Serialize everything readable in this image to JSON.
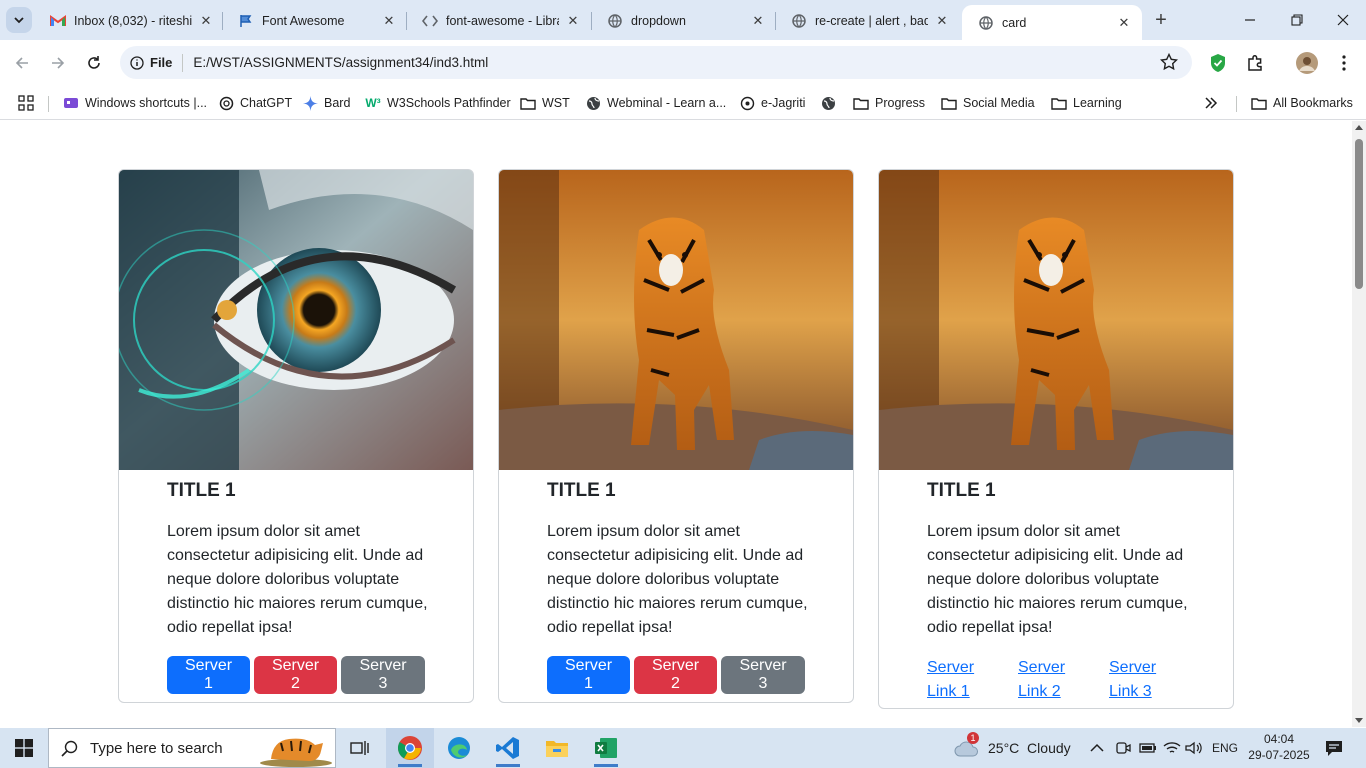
{
  "browser": {
    "tabs": [
      {
        "title": "Inbox (8,032) - riteshi",
        "icon": "gmail-icon"
      },
      {
        "title": "Font Awesome",
        "icon": "font-awesome-icon"
      },
      {
        "title": "font-awesome - Libra",
        "icon": "code-icon"
      },
      {
        "title": "dropdown",
        "icon": "globe-icon"
      },
      {
        "title": "re-create | alert , bad",
        "icon": "globe-icon"
      },
      {
        "title": "card",
        "icon": "globe-icon",
        "active": true
      }
    ],
    "scheme_label": "File",
    "url": "E:/WST/ASSIGNMENTS/assignment34/ind3.html",
    "bookmarks": [
      {
        "label": "Windows shortcuts |...",
        "icon": "app-icon"
      },
      {
        "label": "ChatGPT",
        "icon": "chatgpt-icon"
      },
      {
        "label": "Bard",
        "icon": "sparkle-icon"
      },
      {
        "label": "W3Schools Pathfinder",
        "icon": "w3schools-icon"
      },
      {
        "label": "WST",
        "icon": "folder-icon"
      },
      {
        "label": "Webminal - Learn a...",
        "icon": "globe-icon"
      },
      {
        "label": "e-Jagriti",
        "icon": "seal-icon"
      },
      {
        "label": "",
        "icon": "globe-icon"
      },
      {
        "label": "Progress",
        "icon": "folder-icon"
      },
      {
        "label": "Social Media",
        "icon": "folder-icon"
      },
      {
        "label": "Learning",
        "icon": "folder-icon"
      }
    ],
    "all_bookmarks": "All Bookmarks"
  },
  "cards": [
    {
      "image": "eye-closeup-photo",
      "title": "TITLE 1",
      "text": "Lorem ipsum dolor sit amet consectetur adipisicing elit. Unde ad neque dolore doloribus voluptate distinctio hic maiores rerum cumque, odio repellat ipsa!",
      "buttons": [
        "Server 1",
        "Server 2",
        "Server 3"
      ]
    },
    {
      "image": "tiger-photo",
      "title": "TITLE 1",
      "text": "Lorem ipsum dolor sit amet consectetur adipisicing elit. Unde ad neque dolore doloribus voluptate distinctio hic maiores rerum cumque, odio repellat ipsa!",
      "buttons": [
        "Server 1",
        "Server 2",
        "Server 3"
      ]
    },
    {
      "image": "tiger-photo",
      "title": "TITLE 1",
      "text": "Lorem ipsum dolor sit amet consectetur adipisicing elit. Unde ad neque dolore doloribus voluptate distinctio hic maiores rerum cumque, odio repellat ipsa!",
      "links": [
        {
          "line1": "Server",
          "line2": "Link 1"
        },
        {
          "line1": "Server",
          "line2": "Link 2"
        },
        {
          "line1": "Server",
          "line2": "Link 3"
        }
      ]
    }
  ],
  "colors": {
    "primary": "#0d6efd",
    "danger": "#dc3545",
    "secondary": "#6c757d"
  },
  "taskbar": {
    "search_placeholder": "Type here to search",
    "weather": "25°C  Cloudy",
    "weather_badge": "1",
    "language": "ENG",
    "time": "04:04",
    "date": "29-07-2025"
  }
}
